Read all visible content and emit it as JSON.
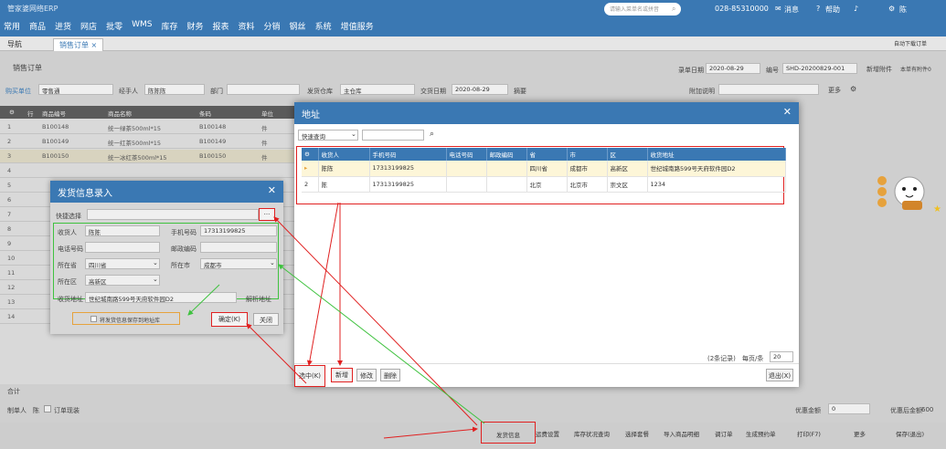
{
  "app": {
    "logo": "管家婆网络ERP",
    "menu": [
      "常用",
      "商品",
      "进货",
      "网店",
      "批零",
      "WMS",
      "库存",
      "财务",
      "报表",
      "资料",
      "分销",
      "钢丝",
      "系统",
      "增值服务"
    ],
    "search_placeholder": "请输入菜单名或拼音",
    "phone": "028-85310000",
    "msg": "消息",
    "help": "帮助",
    "user": "陈"
  },
  "tabs": {
    "nav": "导航",
    "order": "销售订单",
    "right": "自动下载订单"
  },
  "form": {
    "title": "销售订单",
    "date_label": "录单日期",
    "date_value": "2020-08-29",
    "code_label": "编号",
    "code_value": "SHD-20200829-001",
    "attach": "新增附件",
    "history": "本单有附件0",
    "customer_label": "购买单位",
    "customer_value": "零售通",
    "handler_label": "经手人",
    "handler_value": "陈陈陈",
    "dept_label": "部门",
    "warehouse_label": "发货仓库",
    "warehouse_value": "主仓库",
    "deliver_date_label": "交货日期",
    "deliver_date_value": "2020-08-29",
    "summary_label": "摘要",
    "remark_label": "附加说明",
    "more": "更多"
  },
  "grid": {
    "headers": [
      "行",
      "商品编号",
      "商品名称",
      "条码",
      "单位"
    ],
    "rows": [
      {
        "n": "1",
        "code": "B100148",
        "name": "统一绿茶500ml*15",
        "bar": "B100148",
        "unit": "件"
      },
      {
        "n": "2",
        "code": "B100149",
        "name": "统一红茶500ml*15",
        "bar": "B100149",
        "unit": "件"
      },
      {
        "n": "3",
        "code": "B100150",
        "name": "统一冰红茶500ml*15",
        "bar": "B100150",
        "unit": "件"
      },
      {
        "n": "4"
      },
      {
        "n": "5"
      },
      {
        "n": "6"
      },
      {
        "n": "7"
      },
      {
        "n": "8"
      },
      {
        "n": "9"
      },
      {
        "n": "10"
      },
      {
        "n": "11"
      },
      {
        "n": "12"
      },
      {
        "n": "13"
      },
      {
        "n": "14"
      }
    ],
    "total": "合计"
  },
  "bottom": {
    "seller_label": "制单人",
    "seller_value": "陈",
    "print_check": "订单现装",
    "discount_label": "优惠金额",
    "discount_value": "0",
    "after_discount_label": "优惠后金额",
    "after_discount_value": "600",
    "buttons": [
      "发货信息",
      "运费设置",
      "库存状况查询",
      "选择套餐",
      "导入商品明细",
      "调订单",
      "生成预约单",
      "打印(F7)",
      "更多",
      "保存(退出)"
    ]
  },
  "dialog1": {
    "title": "发货信息录入",
    "quick_label": "快捷选择",
    "quick_btn": "···",
    "receiver_label": "收货人",
    "receiver_value": "陈陈",
    "mobile_label": "手机号码",
    "mobile_value": "17313199825",
    "phone_label": "电话号码",
    "zip_label": "邮政编码",
    "province_label": "所在省",
    "province_value": "四川省",
    "city_label": "所在市",
    "city_value": "成都市",
    "district_label": "所在区",
    "district_value": "高新区",
    "address_label": "收货地址",
    "address_value": "世纪城南路599号天府软件园D2",
    "parse_btn": "解析地址",
    "save_check": "将发货信息保存到地址库",
    "ok": "确定(K)",
    "close": "关闭"
  },
  "dialog2": {
    "title": "地址",
    "quick_select": "快速查询",
    "headers": [
      "收货人",
      "手机号码",
      "电话号码",
      "邮政编码",
      "省",
      "市",
      "区",
      "收货地址"
    ],
    "rows": [
      {
        "n": "1",
        "name": "陈陈",
        "mobile": "17313199825",
        "phone": "",
        "zip": "",
        "prov": "四川省",
        "city": "成都市",
        "dist": "高新区",
        "addr": "世纪城南路599号天府软件园D2"
      },
      {
        "n": "2",
        "name": "陈",
        "mobile": "17313199825",
        "phone": "",
        "zip": "",
        "prov": "北京",
        "city": "北京市",
        "dist": "崇文区",
        "addr": "1234"
      }
    ],
    "records": "(2条记录)",
    "per_page_label": "每页/条",
    "per_page": "20",
    "select_btn": "选中(K)",
    "add_btn": "新增",
    "edit_btn": "修改",
    "delete_btn": "删除",
    "exit_btn": "退出(X)"
  },
  "colors": {
    "brand": "#3a78b3",
    "annotation_red": "#e02020",
    "annotation_green": "#3fc23f"
  }
}
